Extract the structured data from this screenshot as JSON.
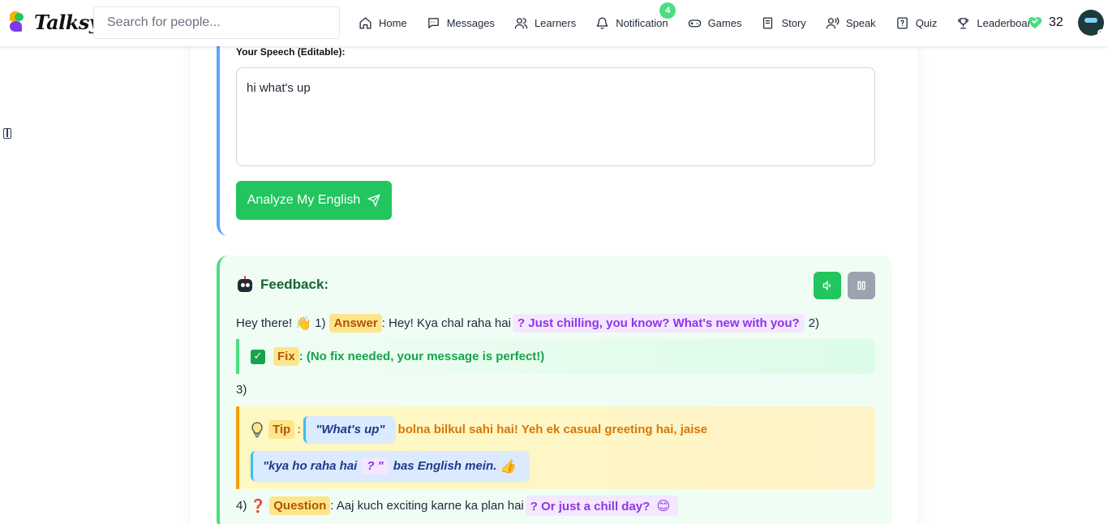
{
  "app": {
    "name": "Talksy",
    "search_placeholder": "Search for people..."
  },
  "nav": {
    "items": [
      {
        "label": "Home",
        "icon": "home-icon"
      },
      {
        "label": "Messages",
        "icon": "message-icon"
      },
      {
        "label": "Learners",
        "icon": "users-icon"
      },
      {
        "label": "Notification",
        "icon": "bell-icon",
        "badge": "4"
      },
      {
        "label": "Games",
        "icon": "gamepad-icon"
      },
      {
        "label": "Story",
        "icon": "book-icon"
      },
      {
        "label": "Speak",
        "icon": "voice-icon"
      },
      {
        "label": "Quiz",
        "icon": "quiz-icon"
      },
      {
        "label": "Leaderboard",
        "icon": "trophy-icon"
      }
    ],
    "hearts_count": "32",
    "accent_color": "#22c55e"
  },
  "speech": {
    "label": "Your Speech (Editable):",
    "text": "hi what's up",
    "analyze_label": "Analyze My English"
  },
  "feedback": {
    "title": "Feedback:",
    "line1": {
      "greeting": "Hey there!",
      "wave": "👋",
      "num1": "1)",
      "answer_tag": "Answer",
      "answer_text": ": Hey! Kya chal raha hai",
      "answer_reply": "? Just chilling, you know? What's new with you?",
      "num2": "2)"
    },
    "fix": {
      "tag": "Fix",
      "text": ": (No fix needed, your message is perfect!)"
    },
    "num3": "3)",
    "tip": {
      "tag": "Tip",
      "colon": ":",
      "quote": "\"What's up\"",
      "text": "bolna bilkul sahi hai! Yeh ek casual greeting hai, jaise",
      "quote2_start": "\"kya ho raha hai",
      "quote2_mark": "? \"",
      "quote2_end": "bas English mein.",
      "thumb": "👍"
    },
    "line4": {
      "num": "4)",
      "question_mark": "❓",
      "tag": "Question",
      "text": ": Aaj kuch exciting karne ka plan hai",
      "reply": "? Or just a chill day?",
      "smile": "😊"
    }
  }
}
